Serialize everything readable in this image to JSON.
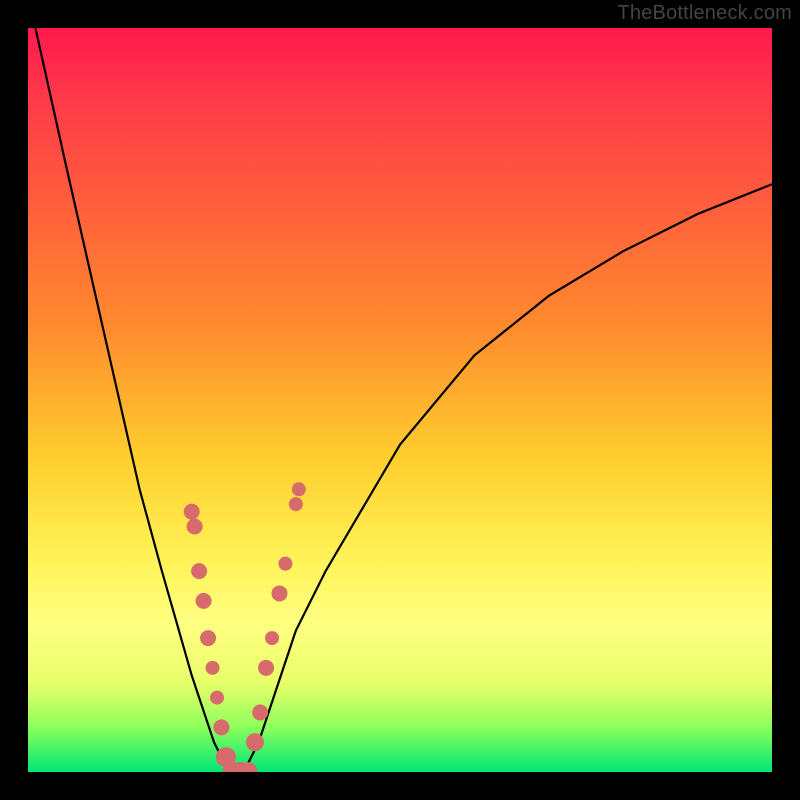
{
  "watermark": "TheBottleneck.com",
  "chart_data": {
    "type": "line",
    "title": "",
    "xlabel": "",
    "ylabel": "",
    "xlim": [
      0,
      100
    ],
    "ylim": [
      0,
      100
    ],
    "grid": false,
    "legend": false,
    "series": [
      {
        "name": "left-curve",
        "x": [
          1,
          5,
          10,
          15,
          18,
          20,
          22,
          23,
          24,
          25,
          26,
          27
        ],
        "y": [
          100,
          82,
          60,
          38,
          27,
          20,
          13,
          10,
          7,
          4,
          2,
          0
        ]
      },
      {
        "name": "right-curve",
        "x": [
          29,
          30,
          31,
          32,
          34,
          36,
          40,
          50,
          60,
          70,
          80,
          90,
          100
        ],
        "y": [
          0,
          2,
          4,
          7,
          13,
          19,
          27,
          44,
          56,
          64,
          70,
          75,
          79
        ]
      }
    ],
    "beads_left": [
      {
        "x": 22.0,
        "y": 35,
        "r": 8
      },
      {
        "x": 22.4,
        "y": 33,
        "r": 8
      },
      {
        "x": 23.0,
        "y": 27,
        "r": 8
      },
      {
        "x": 23.6,
        "y": 23,
        "r": 8
      },
      {
        "x": 24.2,
        "y": 18,
        "r": 8
      },
      {
        "x": 24.8,
        "y": 14,
        "r": 7
      },
      {
        "x": 25.4,
        "y": 10,
        "r": 7
      },
      {
        "x": 26.0,
        "y": 6,
        "r": 8
      },
      {
        "x": 26.6,
        "y": 2,
        "r": 10
      }
    ],
    "beads_bottom": [
      {
        "x": 27.5,
        "y": 0,
        "r": 10
      },
      {
        "x": 28.5,
        "y": 0,
        "r": 10
      },
      {
        "x": 29.5,
        "y": 0,
        "r": 10
      }
    ],
    "beads_right": [
      {
        "x": 30.5,
        "y": 4,
        "r": 9
      },
      {
        "x": 31.2,
        "y": 8,
        "r": 8
      },
      {
        "x": 32.0,
        "y": 14,
        "r": 8
      },
      {
        "x": 32.8,
        "y": 18,
        "r": 7
      },
      {
        "x": 33.8,
        "y": 24,
        "r": 8
      },
      {
        "x": 34.6,
        "y": 28,
        "r": 7
      },
      {
        "x": 36.0,
        "y": 36,
        "r": 7
      },
      {
        "x": 36.4,
        "y": 38,
        "r": 7
      }
    ],
    "colors": {
      "curve": "#000000",
      "bead": "#d76a6a",
      "background_top": "#ff1a4d",
      "background_bottom": "#00e676",
      "frame": "#000000"
    }
  }
}
